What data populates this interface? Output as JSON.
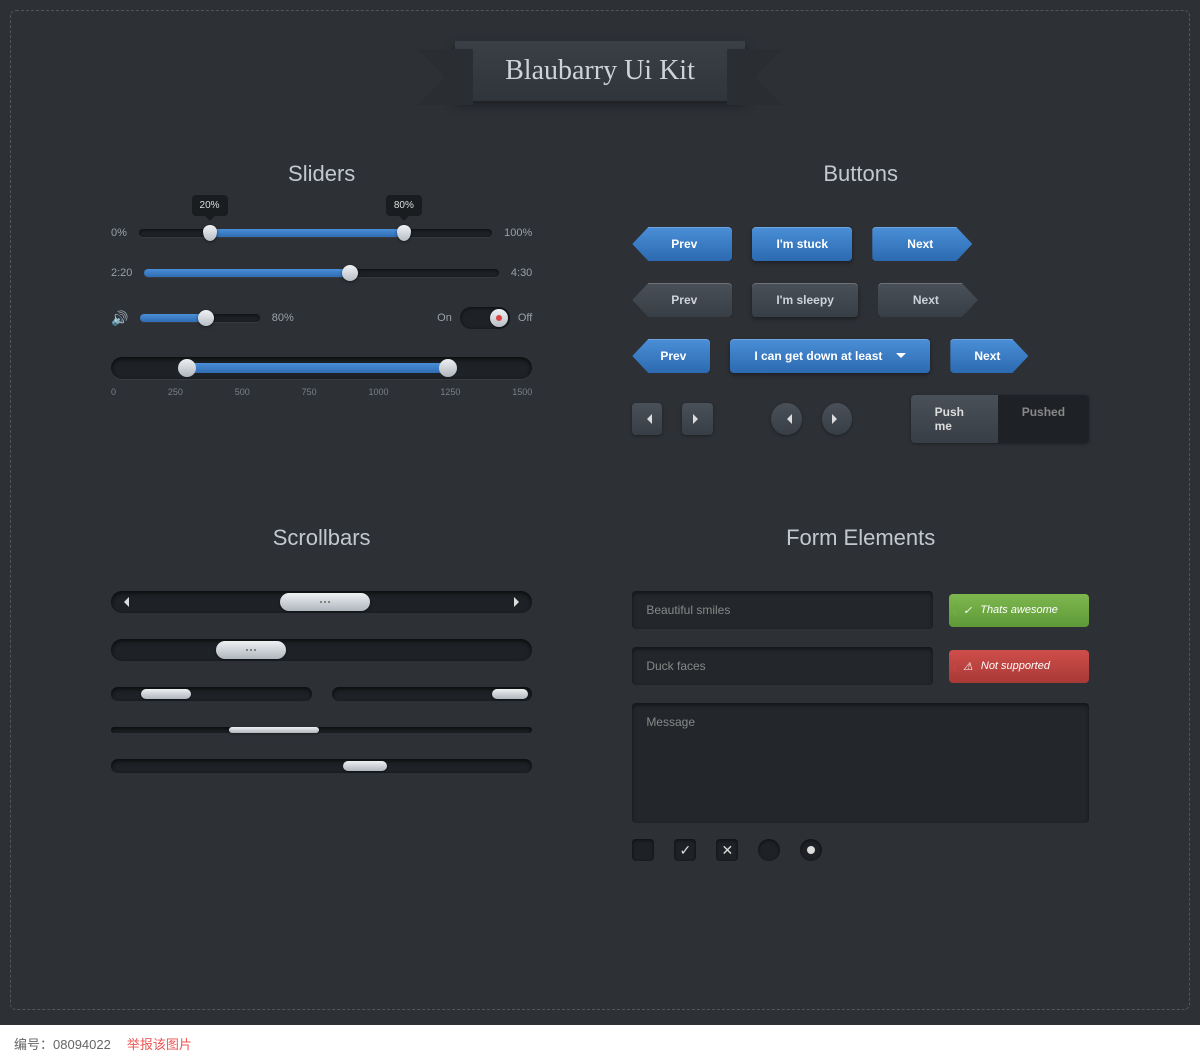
{
  "title": "Blaubarry Ui Kit",
  "sections": {
    "sliders": "Sliders",
    "buttons": "Buttons",
    "scrollbars": "Scrollbars",
    "form": "Form Elements"
  },
  "sliders": {
    "range": {
      "low": "0%",
      "high": "100%",
      "ttLow": "20%",
      "ttHigh": "80%",
      "lowPos": 20,
      "highPos": 75
    },
    "time": {
      "start": "2:20",
      "end": "4:30",
      "pos": 58
    },
    "volume": {
      "label": "80%",
      "pos": 55
    },
    "toggle": {
      "on": "On",
      "off": "Off"
    },
    "scale": {
      "ticks": [
        "0",
        "250",
        "500",
        "750",
        "1000",
        "1250",
        "1500"
      ],
      "low": 18,
      "high": 80
    }
  },
  "buttons": {
    "prev": "Prev",
    "stuck": "I'm stuck",
    "next": "Next",
    "sleepy": "I'm sleepy",
    "dropdown": "I can get down at least",
    "push": "Push me",
    "pushed": "Pushed"
  },
  "form": {
    "smiles": "Beautiful smiles",
    "awesome": "Thats awesome",
    "duck": "Duck faces",
    "unsupported": "Not supported",
    "message": "Message"
  },
  "footer": {
    "id": "编号：",
    "idval": "08094022",
    "link": "举报该图片"
  }
}
